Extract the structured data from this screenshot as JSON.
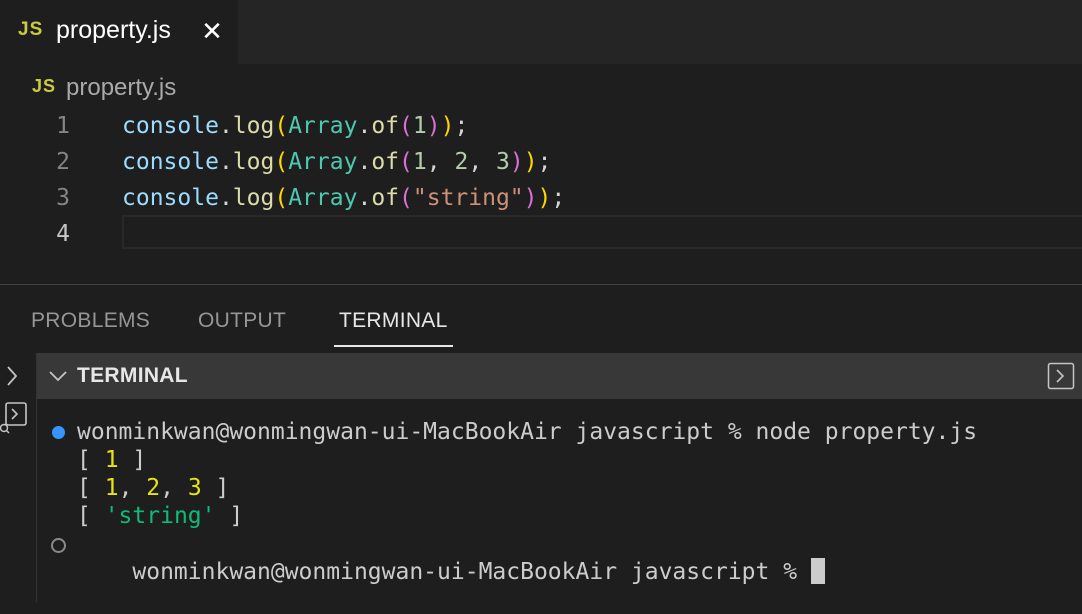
{
  "tabs": [
    {
      "badge": "JS",
      "label": "property.js",
      "close_glyph": "✕"
    }
  ],
  "breadcrumb": {
    "badge": "JS",
    "file": "property.js"
  },
  "editor": {
    "line_numbers": [
      "1",
      "2",
      "3",
      "4"
    ],
    "lines": [
      "console.log(Array.of(1));",
      "console.log(Array.of(1, 2, 3));",
      "console.log(Array.of(\"string\"));",
      ""
    ]
  },
  "panel": {
    "tabs": [
      "PROBLEMS",
      "OUTPUT",
      "TERMINAL"
    ],
    "active_tab": "TERMINAL",
    "header_title": "TERMINAL"
  },
  "terminal": {
    "lines": [
      "wonminkwan@wonmingwan-ui-MacBookAir javascript % node property.js",
      "[ 1 ]",
      "[ 1, 2, 3 ]",
      "[ 'string' ]",
      "wonminkwan@wonmingwan-ui-MacBookAir javascript % "
    ]
  },
  "colors": {
    "js_badge": "#cbcb41",
    "accent_dot": "#3794ff",
    "string_green": "#0dbc79",
    "number_yellow": "#e5e510"
  },
  "icons": [
    "close-icon",
    "chevron-right-icon",
    "chevron-down-icon",
    "split-terminal-icon",
    "terminal-launch-icon"
  ]
}
